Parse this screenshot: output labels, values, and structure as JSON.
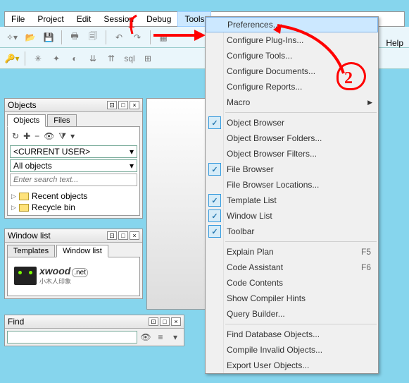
{
  "menubar": {
    "items": [
      "File",
      "Project",
      "Edit",
      "Session",
      "Debug",
      "Tools"
    ],
    "open": "Tools"
  },
  "help_label": "Help",
  "objects": {
    "title": "Objects",
    "tabs": [
      "Objects",
      "Files"
    ],
    "user_selector": "<CURRENT USER>",
    "scope_selector": "All objects",
    "search_placeholder": "Enter search text...",
    "tree": [
      "Recent objects",
      "Recycle bin"
    ]
  },
  "windowlist": {
    "title": "Window list",
    "tabs": [
      "Templates",
      "Window list"
    ]
  },
  "logo": {
    "text": "xwood",
    "tld": ".net",
    "sub": "小木人印象"
  },
  "find": {
    "title": "Find"
  },
  "menu": {
    "groups": [
      [
        {
          "label": "Preferences...",
          "hover": true
        },
        {
          "label": "Configure Plug-Ins..."
        },
        {
          "label": "Configure Tools..."
        },
        {
          "label": "Configure Documents..."
        },
        {
          "label": "Configure Reports..."
        },
        {
          "label": "Macro",
          "submenu": true
        }
      ],
      [
        {
          "label": "Object Browser",
          "checked": true
        },
        {
          "label": "Object Browser Folders..."
        },
        {
          "label": "Object Browser Filters..."
        },
        {
          "label": "File Browser",
          "checked": true
        },
        {
          "label": "File Browser Locations..."
        },
        {
          "label": "Template List",
          "checked": true
        },
        {
          "label": "Window List",
          "checked": true
        },
        {
          "label": "Toolbar",
          "checked": true
        }
      ],
      [
        {
          "label": "Explain Plan",
          "shortcut": "F5"
        },
        {
          "label": "Code Assistant",
          "shortcut": "F6"
        },
        {
          "label": "Code Contents"
        },
        {
          "label": "Show Compiler Hints"
        },
        {
          "label": "Query Builder..."
        }
      ],
      [
        {
          "label": "Find Database Objects..."
        },
        {
          "label": "Compile Invalid Objects..."
        },
        {
          "label": "Export User Objects..."
        }
      ]
    ]
  },
  "annotations": {
    "one": "1",
    "two": "2"
  }
}
